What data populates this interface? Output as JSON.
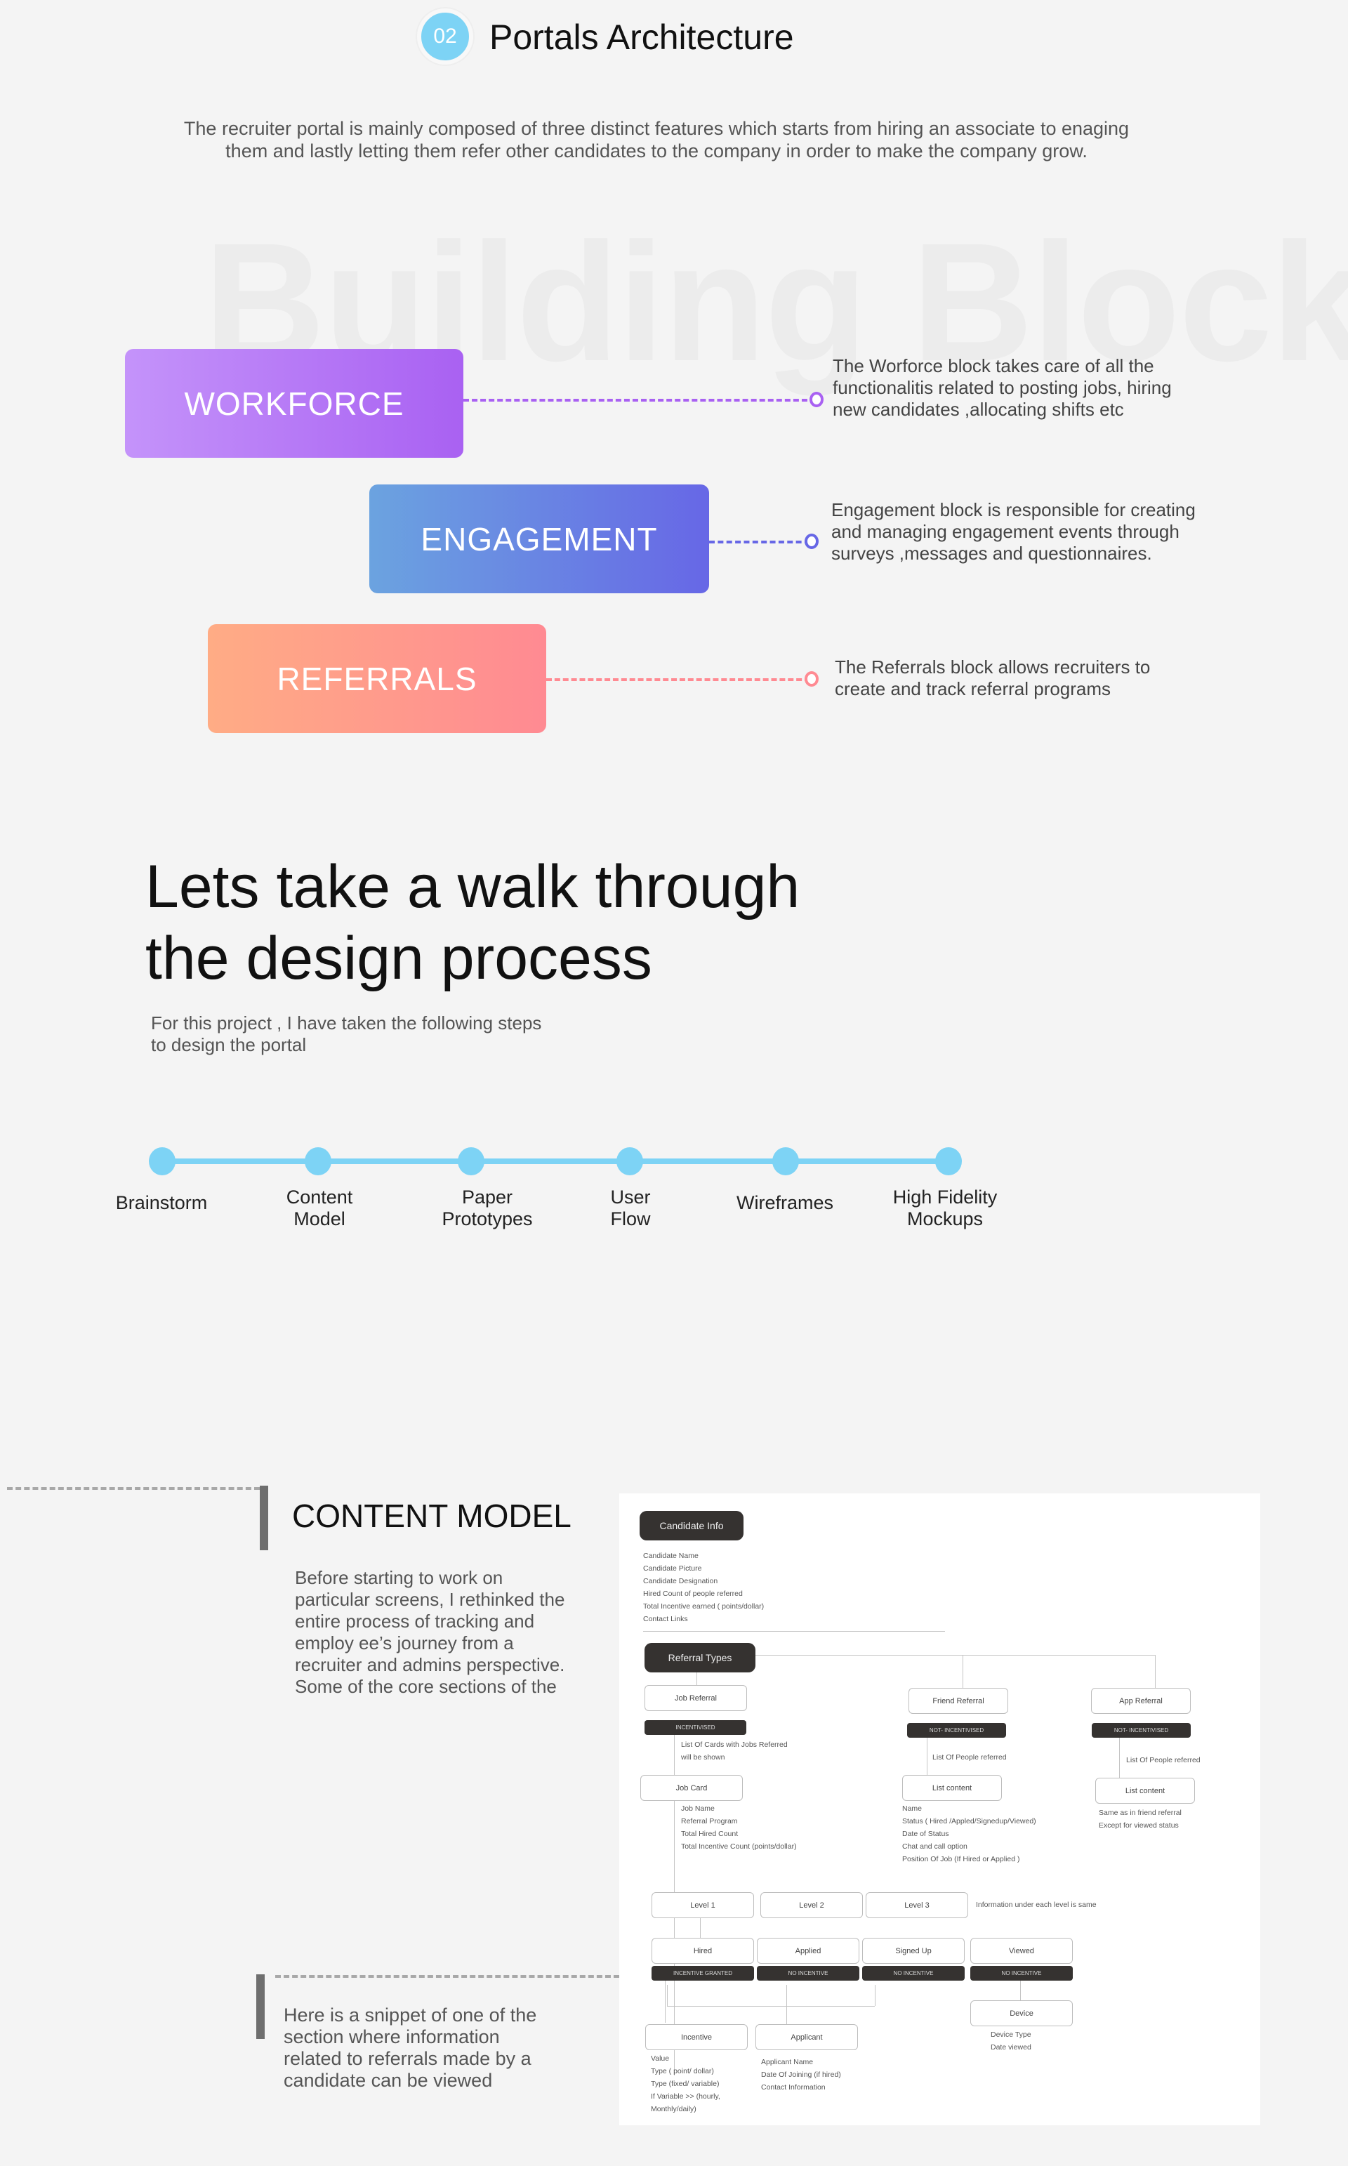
{
  "header": {
    "section_number": "02",
    "title": "Portals Architecture",
    "intro": "The recruiter portal is mainly composed of three distinct features which starts from hiring an associate to enaging them and lastly letting them refer other candidates to the company in order to make the company grow."
  },
  "watermark": "Building Blocks",
  "blocks": [
    {
      "label": "WORKFORCE",
      "color": "#a961f2",
      "description": "The Worforce block takes care of all the functionalitis related to posting jobs, hiring new candidates ,allocating shifts etc"
    },
    {
      "label": "ENGAGEMENT",
      "color": "#6767e6",
      "description": "Engagement block is responsible for creating and managing engagement events through surveys ,messages and questionnaires."
    },
    {
      "label": "REFERRALS",
      "color": "#ff8a92",
      "description": "The Referrals block allows recruiters to create and track referral programs"
    }
  ],
  "process": {
    "title_line1": "Lets take a walk through",
    "title_line2": "the design process",
    "subtitle": "For this project , I have taken the following steps to design the portal",
    "accent": "#7dd3f5",
    "steps": [
      {
        "line1": "Brainstorm",
        "line2": ""
      },
      {
        "line1": "Content",
        "line2": "Model"
      },
      {
        "line1": "Paper",
        "line2": "Prototypes"
      },
      {
        "line1": "User",
        "line2": "Flow"
      },
      {
        "line1": "Wireframes",
        "line2": ""
      },
      {
        "line1": "High Fidelity",
        "line2": "Mockups"
      }
    ]
  },
  "content_model": {
    "title": "CONTENT MODEL",
    "text": "Before starting to work on particular screens, I rethinked the entire process of tracking and employ ee’s journey from a recruiter and admins perspective. Some of the core sections of the",
    "snippet_text": "Here is a snippet of one of the section where information related to referrals made by a candidate can be viewed"
  },
  "diagram": {
    "candidate_info": {
      "label": "Candidate Info",
      "fields": [
        "Candidate Name",
        "Candidate Picture",
        "Candidate Designation",
        "Hired Count of people referred",
        "Total Incentive earned ( points/dollar)",
        "Contact Links"
      ]
    },
    "referral_types": {
      "label": "Referral Types",
      "job": {
        "label": "Job Referral",
        "tag": "INCENTIVISED",
        "note": [
          "List Of  Cards with Jobs Referred",
          "will be shown"
        ]
      },
      "job_card": {
        "label": "Job Card",
        "fields": [
          "Job Name",
          "Referral Program",
          "Total Hired Count",
          "Total Incentive Count (points/dollar)"
        ]
      },
      "friend": {
        "label": "Friend Referral",
        "tag": "NOT- INCENTIVISED",
        "note": "List Of  People referred",
        "list_label": "List content",
        "fields": [
          "Name",
          "Status ( Hired /Appled/Signedup/Viewed)",
          "Date of Status",
          "Chat and call option",
          "Position Of Job (If Hired or Applied )"
        ]
      },
      "app": {
        "label": "App Referral",
        "tag": "NOT- INCENTIVISED",
        "note": "List Of  People referred",
        "list_label": "List content",
        "fields": [
          "Same as in friend referral",
          "Except for viewed status"
        ]
      }
    },
    "levels": {
      "items": [
        "Level 1",
        "Level 2",
        "Level 3"
      ],
      "note": "Information under each level is same"
    },
    "statuses": [
      {
        "label": "Hired",
        "tag": "INCENTIVE GRANTED"
      },
      {
        "label": "Applied",
        "tag": "NO INCENTIVE"
      },
      {
        "label": "Signed Up",
        "tag": "NO INCENTIVE"
      },
      {
        "label": "Viewed",
        "tag": "NO INCENTIVE"
      }
    ],
    "incentive": {
      "label": "Incentive",
      "fields": [
        "Value",
        "Type ( point/ dollar)",
        "Type (fixed/ variable)",
        "If Variable >> (hourly,",
        "Monthly/daily)"
      ]
    },
    "applicant": {
      "label": "Applicant",
      "fields": [
        "Applicant Name",
        "Date Of Joining (if hired)",
        "Contact Information"
      ]
    },
    "device": {
      "label": "Device",
      "fields": [
        "Device Type",
        "Date viewed"
      ]
    }
  }
}
